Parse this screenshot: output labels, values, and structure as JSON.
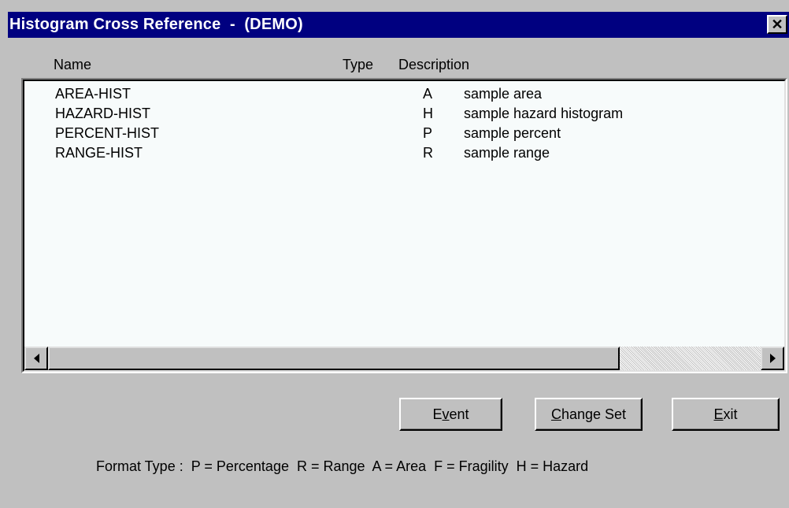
{
  "window": {
    "title": "Histogram Cross Reference  -  (DEMO)",
    "close_glyph": "✕"
  },
  "columns": {
    "name": "Name",
    "type": "Type",
    "description": "Description"
  },
  "rows": [
    {
      "name": "AREA-HIST",
      "code": "A",
      "description": "sample area"
    },
    {
      "name": "HAZARD-HIST",
      "code": "H",
      "description": "sample hazard histogram"
    },
    {
      "name": "PERCENT-HIST",
      "code": "P",
      "description": "sample percent"
    },
    {
      "name": "RANGE-HIST",
      "code": "R",
      "description": "sample range"
    }
  ],
  "buttons": {
    "event": {
      "before": "E",
      "mnemonic": "v",
      "after": "ent"
    },
    "change_set": {
      "before": "",
      "mnemonic": "C",
      "after": "hange Set"
    },
    "exit": {
      "before": "",
      "mnemonic": "E",
      "after": "xit"
    }
  },
  "legend": "Format Type :  P = Percentage  R = Range  A = Area  F = Fragility  H = Hazard",
  "colors": {
    "titlebar": "#000080",
    "face": "#c0c0c0",
    "list_background": "#f7fbfb"
  }
}
